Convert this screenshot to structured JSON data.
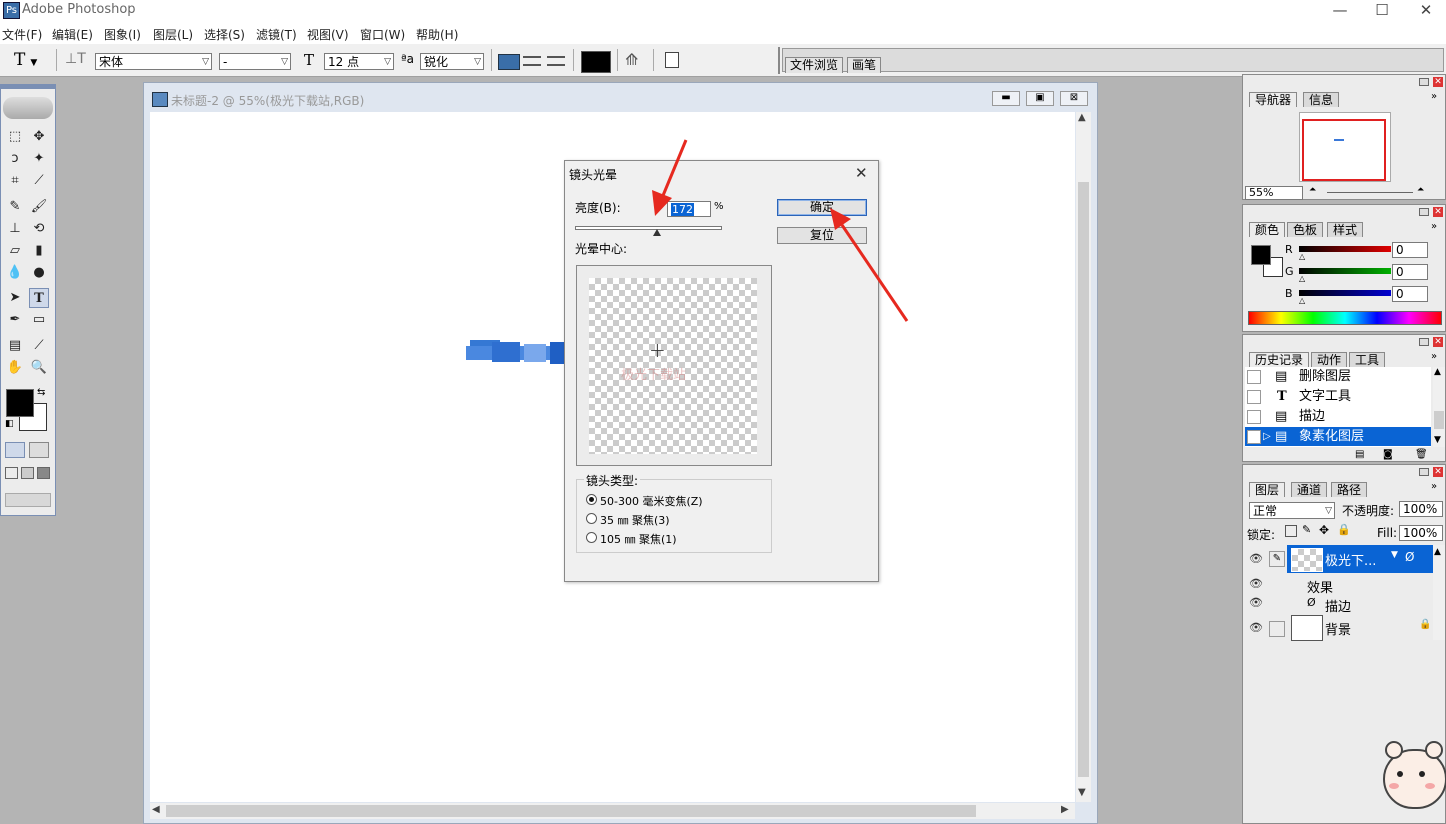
{
  "app": {
    "title": "Adobe Photoshop",
    "icon": "photoshop-app-icon"
  },
  "window_controls": {
    "minimize": "—",
    "maximize": "☐",
    "close": "✕"
  },
  "menu": [
    "文件(F)",
    "编辑(E)",
    "图象(I)",
    "图层(L)",
    "选择(S)",
    "滤镜(T)",
    "视图(V)",
    "窗口(W)",
    "帮助(H)"
  ],
  "options": {
    "tool_glyph": "T",
    "font_family": "宋体",
    "font_style": "-",
    "font_size": "12 点",
    "antialias": "锐化",
    "aa_glyph": "ªa",
    "size_glyph": "T",
    "color": "#000000",
    "wells": [
      "文件浏览",
      "画笔"
    ]
  },
  "document": {
    "title": "未标题-2 @ 55%(极光下载站,RGB)"
  },
  "dialog": {
    "title": "镜头光晕",
    "brightness_label": "亮度(B):",
    "brightness_value": "172",
    "percent": "%",
    "brightness_slider": 0.56,
    "ok": "确定",
    "reset": "复位",
    "center_label": "光晕中心:",
    "preview_watermark": "极光下载站",
    "lens_type_label": "镜头类型:",
    "lens_options": [
      {
        "label": "50-300 毫米变焦(Z)",
        "selected": true
      },
      {
        "label": "35 ㎜ 聚焦(3)",
        "selected": false
      },
      {
        "label": "105 ㎜ 聚焦(1)",
        "selected": false
      }
    ]
  },
  "navigator": {
    "tabs": [
      "导航器",
      "信息"
    ],
    "zoom": "55%"
  },
  "color_panel": {
    "tabs": [
      "颜色",
      "色板",
      "样式"
    ],
    "channels": [
      {
        "name": "R",
        "value": "0",
        "color": "#e00000"
      },
      {
        "name": "G",
        "value": "0",
        "color": "#00b000"
      },
      {
        "name": "B",
        "value": "0",
        "color": "#0000d0"
      }
    ]
  },
  "history": {
    "tabs": [
      "历史记录",
      "动作",
      "工具"
    ],
    "items": [
      {
        "label": "删除图层",
        "icon": "history-state-icon",
        "selected": false
      },
      {
        "label": "文字工具",
        "icon": "type-tool-icon",
        "selected": false
      },
      {
        "label": "描边",
        "icon": "history-state-icon",
        "selected": false
      },
      {
        "label": "象素化图层",
        "icon": "history-state-icon",
        "selected": true
      }
    ]
  },
  "layers": {
    "tabs": [
      "图层",
      "通道",
      "路径"
    ],
    "blend_mode": "正常",
    "opacity_label": "不透明度:",
    "opacity": "100%",
    "lock_label": "锁定:",
    "fill_label": "Fill:",
    "fill": "100%",
    "items": [
      {
        "label": "极光下...",
        "selected": true
      },
      {
        "label": "效果",
        "selected": false
      },
      {
        "label": "描边",
        "selected": false
      },
      {
        "label": "背景",
        "selected": false
      }
    ]
  },
  "colors": {
    "selection": "#0a64d4",
    "arrow": "#e6291f"
  }
}
